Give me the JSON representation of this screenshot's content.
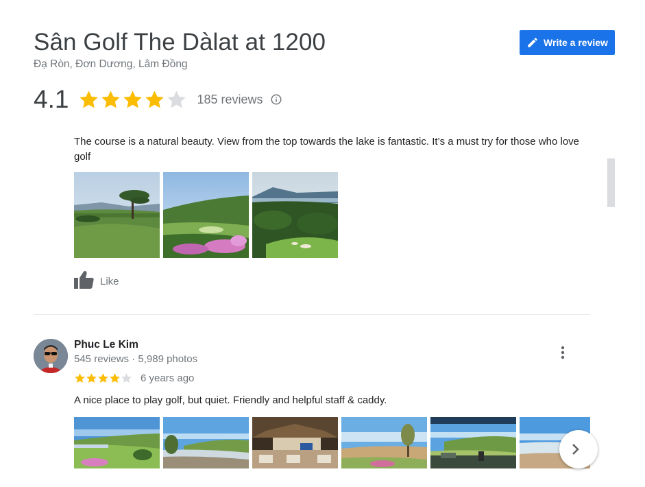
{
  "place": {
    "title": "Sân Golf The Dàlat at 1200",
    "address": "Đạ Ròn, Đơn Dương, Lâm Đồng",
    "rating": "4.1",
    "stars_filled": 4,
    "stars_total": 5,
    "review_count": "185 reviews",
    "info_icon": "info-circle-icon"
  },
  "actions": {
    "write_review_label": "Write a review",
    "write_review_icon": "pencil-icon"
  },
  "review1": {
    "text": "The course is a natural beauty. View from the top towards the lake is fantastic. It’s a must try for those who love golf",
    "photos": [
      "golf-course-photo",
      "golf-course-photo",
      "golf-course-photo"
    ],
    "like_label": "Like",
    "like_icon": "thumbs-up-icon"
  },
  "review2": {
    "reviewer_name": "Phuc Le Kim",
    "reviewer_stats": "545 reviews · 5,989 photos",
    "stars_filled": 4,
    "stars_total": 5,
    "age": "6 years ago",
    "text": "A nice place to play golf, but quiet. Friendly and helpful staff & caddy.",
    "photos": [
      "golf-course-photo",
      "golf-course-photo",
      "clubhouse-photo",
      "golf-course-photo",
      "golf-course-photo",
      "golf-course-photo"
    ],
    "more_icon": "more-vertical-icon",
    "next_icon": "chevron-right-icon"
  },
  "colors": {
    "accent": "#1a73e8",
    "star": "#fbbc04",
    "star_empty": "#dadce0",
    "text_secondary": "#70757a"
  }
}
